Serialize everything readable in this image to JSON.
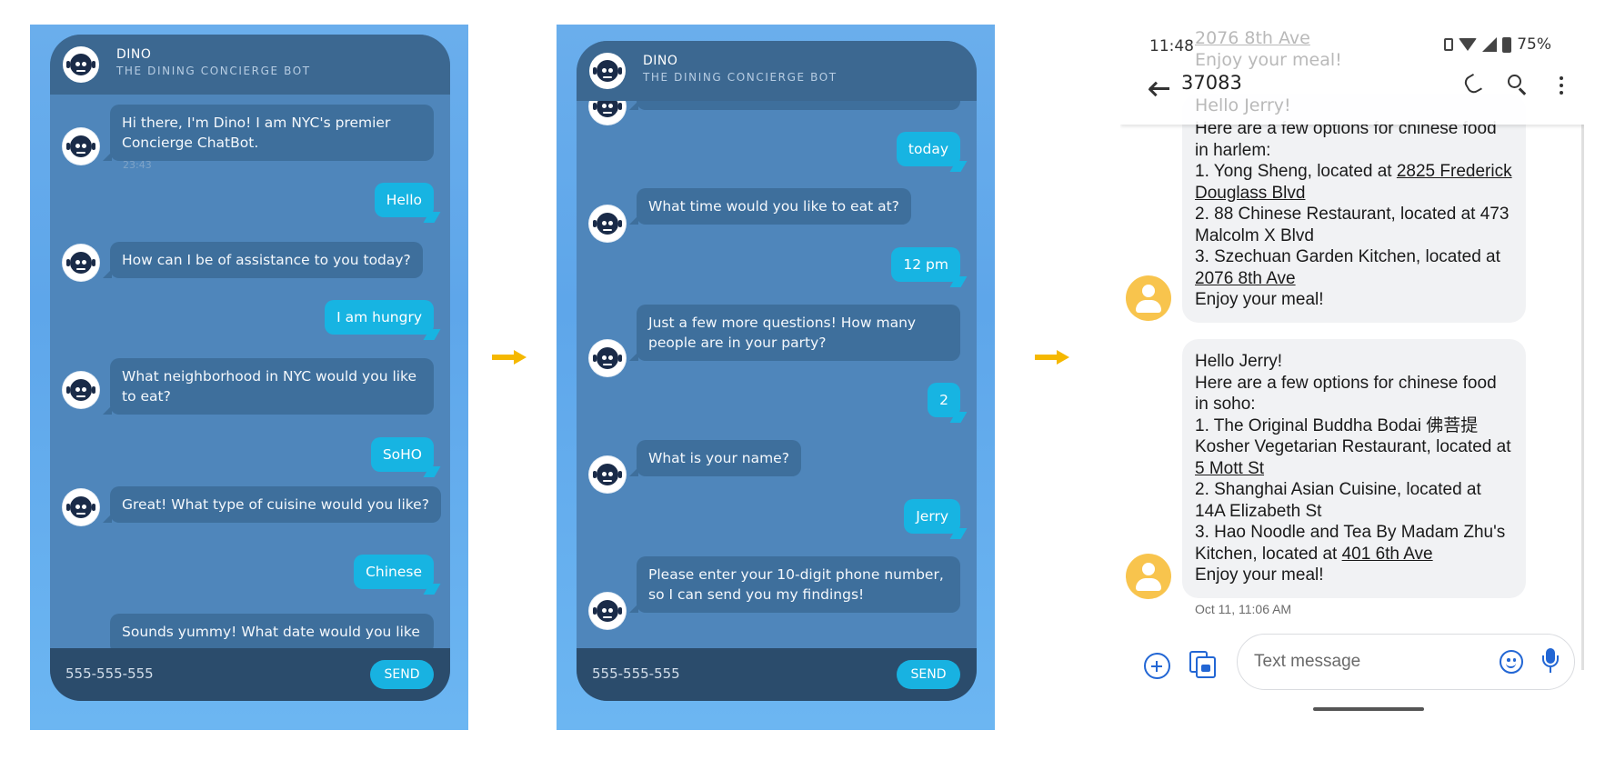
{
  "chat1": {
    "header": {
      "name": "DINO",
      "subtitle": "THE DINING CONCIERGE BOT"
    },
    "messages": [
      {
        "from": "bot",
        "text": "Hi there, I'm Dino! I am NYC's premier Concierge ChatBot.",
        "time": "23:43"
      },
      {
        "from": "user",
        "text": "Hello"
      },
      {
        "from": "bot",
        "text": "How can I be of assistance to you today?"
      },
      {
        "from": "user",
        "text": "I am hungry"
      },
      {
        "from": "bot",
        "text": "What neighborhood in NYC would you like to eat?"
      },
      {
        "from": "user",
        "text": "SoHO"
      },
      {
        "from": "bot",
        "text": "Great! What type of cuisine would you like?"
      },
      {
        "from": "user",
        "text": "Chinese"
      },
      {
        "from": "bot",
        "text": "Sounds yummy! What date would you like"
      }
    ],
    "input": {
      "value": "555-555-555",
      "send_label": "SEND"
    }
  },
  "chat2": {
    "header": {
      "name": "DINO",
      "subtitle": "THE DINING CONCIERGE BOT"
    },
    "messages": [
      {
        "from": "user",
        "text": "today"
      },
      {
        "from": "bot",
        "text": "What time would you like to eat at?"
      },
      {
        "from": "user",
        "text": "12 pm"
      },
      {
        "from": "bot",
        "text": "Just a few more questions! How many people are in your party?"
      },
      {
        "from": "user",
        "text": "2"
      },
      {
        "from": "bot",
        "text": "What is your name?"
      },
      {
        "from": "user",
        "text": "Jerry"
      },
      {
        "from": "bot",
        "text": "Please enter your 10-digit phone number, so I can send you my findings!"
      }
    ],
    "input": {
      "value": "555-555-555",
      "send_label": "SEND"
    }
  },
  "sms": {
    "status": {
      "time": "11:48",
      "battery": "75%"
    },
    "title": "37083",
    "ghost_lines": [
      "2076 8th Ave",
      "Enjoy your meal!",
      "Hello Jerry!"
    ],
    "message1": {
      "l1": "Here are a few options for chinese food in harlem:",
      "l2a": "1. Yong Sheng, located at ",
      "l2u": "2825 Frederick Douglass Blvd",
      "l3": "2. 88 Chinese Restaurant, located at 473 Malcolm X Blvd",
      "l4": "3. Szechuan Garden Kitchen, located at ",
      "l4u": "2076 8th Ave",
      "l5": "Enjoy your meal!"
    },
    "message2": {
      "l0": "Hello Jerry!",
      "l1": "Here are a few options for chinese food in soho:",
      "l2": "1. The Original Buddha Bodai 佛菩提 Kosher Vegetarian Restaurant, located at ",
      "l2u": "5 Mott St",
      "l3": "2. Shanghai Asian Cuisine, located at 14A Elizabeth St",
      "l4": "3. Hao Noodle and Tea By Madam Zhu's Kitchen, located at ",
      "l4u": "401 6th Ave",
      "l5": "Enjoy your meal!"
    },
    "timestamp": "Oct 11, 11:06 AM",
    "compose_placeholder": "Text message"
  },
  "colors": {
    "chat_bg": "#5ea6ea",
    "bot_bubble": "#3e6f9c",
    "user_bubble": "#17b4e2",
    "arrow": "#f5b800",
    "sms_accent": "#2266d4",
    "contact_avatar": "#f8c44d"
  }
}
